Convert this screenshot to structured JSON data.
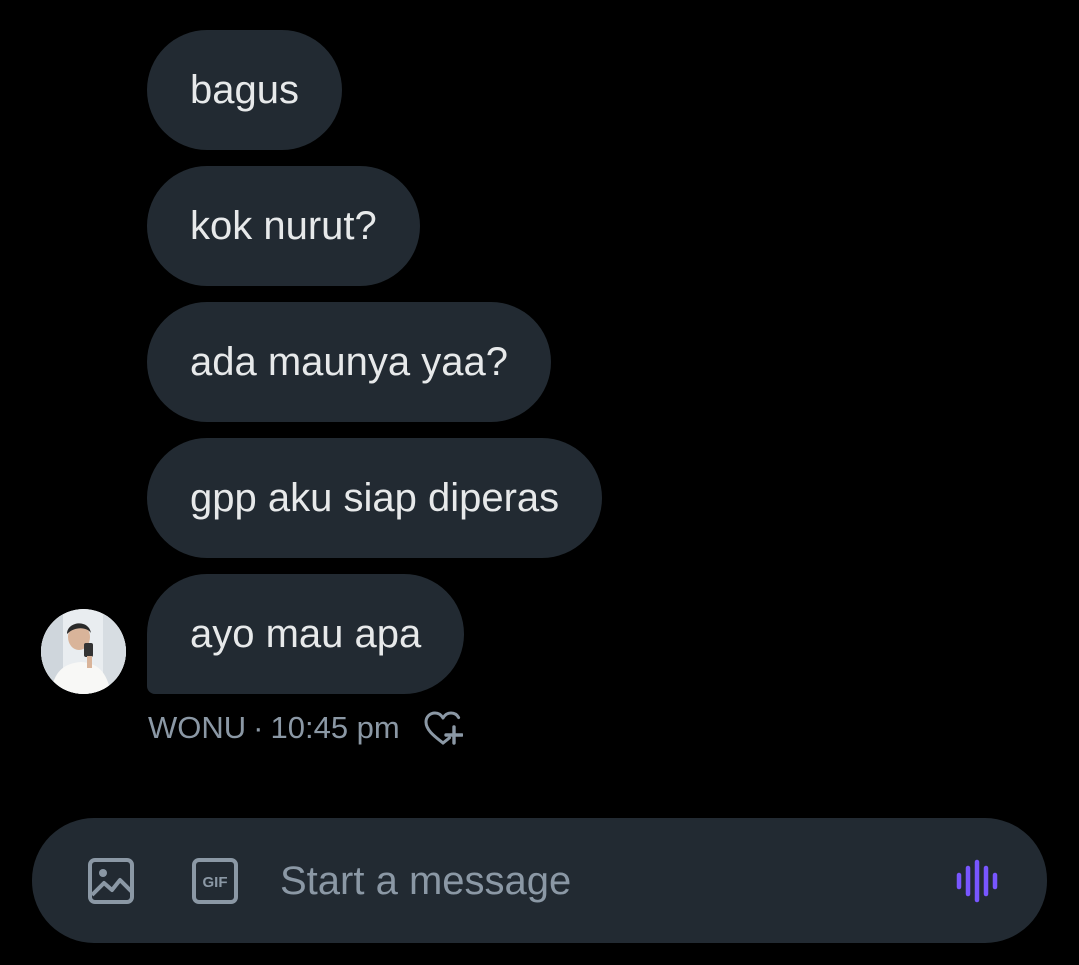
{
  "messages": [
    {
      "text": "bagus"
    },
    {
      "text": "kok nurut?"
    },
    {
      "text": "ada maunya yaa?"
    },
    {
      "text": "gpp aku siap diperas"
    },
    {
      "text": "ayo mau apa"
    }
  ],
  "meta": {
    "sender": "WONU",
    "separator": "·",
    "time": "10:45 pm",
    "react_icon": "heart-plus-icon"
  },
  "composer": {
    "placeholder": "Start a message",
    "media_icon": "image-icon",
    "gif_label": "GIF",
    "voice_icon": "voice-wave-icon"
  },
  "colors": {
    "background": "#000000",
    "bubble": "#222a32",
    "text": "#e7e9ea",
    "muted": "#8b98a5",
    "voice_accent": "#7856ff"
  }
}
